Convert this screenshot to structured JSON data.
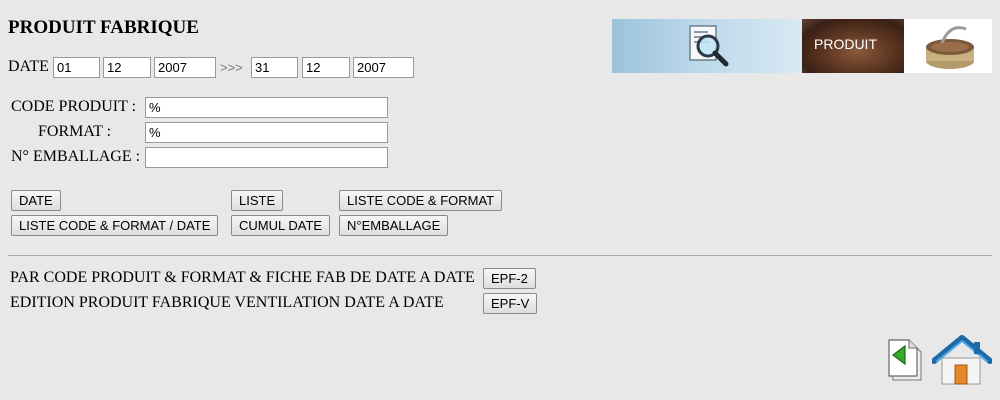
{
  "page": {
    "title": "PRODUIT FABRIQUE"
  },
  "date_range": {
    "label": "DATE",
    "arrow": ">>>",
    "from": {
      "day": "01",
      "month": "12",
      "year": "2007"
    },
    "to": {
      "day": "31",
      "month": "12",
      "year": "2007"
    }
  },
  "fields": {
    "code_produit": {
      "label": "CODE PRODUIT :",
      "value": "%"
    },
    "format": {
      "label": "FORMAT :",
      "value": "%"
    },
    "emballage": {
      "label": "N° EMBALLAGE :",
      "value": ""
    }
  },
  "buttons": {
    "date": "DATE",
    "liste": "LISTE",
    "liste_code_format": "LISTE CODE & FORMAT",
    "liste_code_format_date": "LISTE CODE & FORMAT / DATE",
    "cumul_date": "CUMUL DATE",
    "n_emballage": "N°EMBALLAGE"
  },
  "reports": [
    {
      "label": "PAR CODE PRODUIT & FORMAT & FICHE FAB DE DATE A DATE",
      "button": "EPF-2"
    },
    {
      "label": "EDITION PRODUIT FABRIQUE VENTILATION DATE A DATE",
      "button": "EPF-V"
    }
  ],
  "banner": {
    "text": "PRODUIT"
  },
  "icons": {
    "search": "search-document-icon",
    "back": "back-arrow-icon",
    "home": "home-icon"
  }
}
